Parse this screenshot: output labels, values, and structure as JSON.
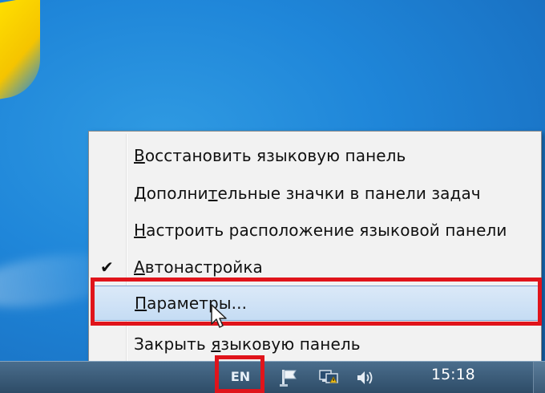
{
  "context_menu": {
    "items": [
      {
        "prefix": "",
        "underlined": "В",
        "rest": "осстановить языковую панель",
        "checked": false,
        "selected": false
      },
      {
        "prefix": "Дополни",
        "underlined": "т",
        "rest": "ельные значки в панели задач",
        "checked": false,
        "selected": false
      },
      {
        "prefix": "",
        "underlined": "Н",
        "rest": "астроить расположение языковой панели",
        "checked": false,
        "selected": false
      },
      {
        "prefix": "",
        "underlined": "А",
        "rest": "втонастройка",
        "checked": true,
        "selected": false
      },
      {
        "prefix": "",
        "underlined": "П",
        "rest": "араметры...",
        "checked": false,
        "selected": true
      },
      {
        "prefix": "Закрыть ",
        "underlined": "я",
        "rest": "зыковую панель",
        "checked": false,
        "selected": false
      }
    ]
  },
  "taskbar": {
    "language": "EN",
    "clock": "15:18"
  },
  "icons": {
    "check": "check-icon",
    "tray": [
      "action-center-flag-icon",
      "network-icon",
      "volume-icon"
    ],
    "cursor": "mouse-pointer-icon"
  },
  "colors": {
    "highlight_red": "#e0141b",
    "selection_blue": "#c5dcf4",
    "desktop_blue": "#1f86d9"
  }
}
